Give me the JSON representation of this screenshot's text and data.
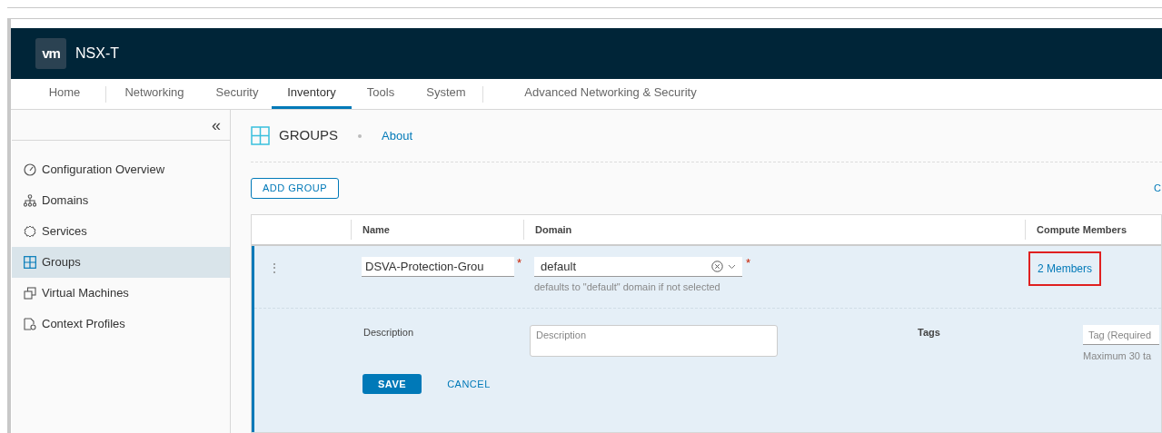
{
  "app": {
    "logo": "vm",
    "title": "NSX-T"
  },
  "nav_tabs": [
    {
      "label": "Home",
      "selected": false
    },
    {
      "label": "Networking",
      "selected": false
    },
    {
      "label": "Security",
      "selected": false
    },
    {
      "label": "Inventory",
      "selected": true
    },
    {
      "label": "Tools",
      "selected": false
    },
    {
      "label": "System",
      "selected": false
    },
    {
      "label": "Advanced Networking & Security",
      "selected": false
    }
  ],
  "sidebar": {
    "collapse": "«",
    "items": [
      {
        "label": "Configuration Overview",
        "selected": false
      },
      {
        "label": "Domains",
        "selected": false
      },
      {
        "label": "Services",
        "selected": false
      },
      {
        "label": "Groups",
        "selected": true
      },
      {
        "label": "Virtual Machines",
        "selected": false
      },
      {
        "label": "Context Profiles",
        "selected": false
      }
    ]
  },
  "page": {
    "title": "GROUPS",
    "about": "About",
    "add_button": "ADD GROUP",
    "right_action": "C"
  },
  "table": {
    "columns": [
      "Name",
      "Domain",
      "Compute Members"
    ],
    "edit_row": {
      "menu": "⋮",
      "name_value": "DSVA-Protection-Grou",
      "required": "*",
      "domain_value": "default",
      "domain_hint": "defaults to \"default\" domain if not selected",
      "members": "2 Members",
      "members_highlighted": true,
      "description_label": "Description",
      "description_placeholder": "Description",
      "tags_label": "Tags",
      "tags_placeholder": "Tag (Required",
      "tags_hint": "Maximum 30 ta",
      "save": "SAVE",
      "cancel": "CANCEL"
    }
  }
}
